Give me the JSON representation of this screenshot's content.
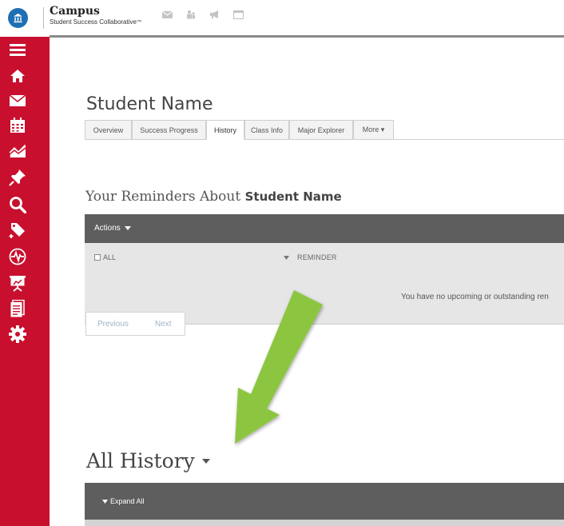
{
  "header": {
    "brand_name": "Campus",
    "brand_sub": "Student Success Collaborative",
    "brand_tm": "™",
    "icons": [
      "mail-icon",
      "people-icon",
      "megaphone-icon",
      "window-icon"
    ]
  },
  "sidebar": {
    "items": [
      "menu-icon",
      "home-icon",
      "mail-icon",
      "calendar-icon",
      "chart-icon",
      "pin-icon",
      "search-icon",
      "tag-add-icon",
      "pulse-icon",
      "presentation-icon",
      "document-icon",
      "gear-icon"
    ]
  },
  "page": {
    "title": "Student Name",
    "tabs": [
      {
        "label": "Overview",
        "active": false
      },
      {
        "label": "Success Progress",
        "active": false
      },
      {
        "label": "History",
        "active": true
      },
      {
        "label": "Class Info",
        "active": false
      },
      {
        "label": "Major Explorer",
        "active": false
      },
      {
        "label": "More ▾",
        "active": false
      }
    ]
  },
  "reminders": {
    "title_prefix": "Your Reminders About",
    "title_name": "Student Name",
    "actions_label": "Actions",
    "all_label": "ALL",
    "column_reminder": "REMINDER",
    "empty_message": "You have no upcoming or outstanding ren",
    "previous_label": "Previous",
    "next_label": "Next"
  },
  "history": {
    "title": "All History",
    "expand_all_label": "Expand All"
  },
  "colors": {
    "sidebar": "#c8102e",
    "panel_header": "#5e5e5e",
    "panel_body": "#e6e6e6",
    "arrow": "#8cc63f",
    "logo": "#1e6fb3"
  }
}
